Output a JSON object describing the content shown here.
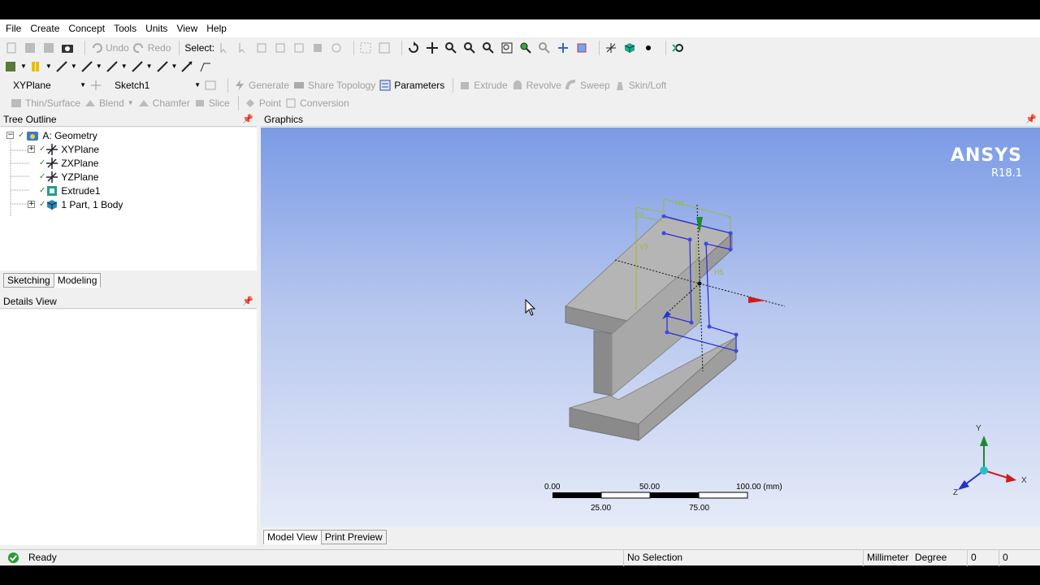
{
  "menubar": [
    "File",
    "Create",
    "Concept",
    "Tools",
    "Units",
    "View",
    "Help"
  ],
  "toolbar1": {
    "undo": "Undo",
    "redo": "Redo",
    "select": "Select:"
  },
  "toolbar3": {
    "plane": "XYPlane",
    "sketch": "Sketch1",
    "generate": "Generate",
    "share_topology": "Share Topology",
    "parameters": "Parameters",
    "extrude": "Extrude",
    "revolve": "Revolve",
    "sweep": "Sweep",
    "skin_loft": "Skin/Loft"
  },
  "toolbar4": {
    "thin_surface": "Thin/Surface",
    "blend": "Blend",
    "chamfer": "Chamfer",
    "slice": "Slice",
    "point": "Point",
    "conversion": "Conversion"
  },
  "tree": {
    "header": "Tree Outline",
    "root": "A: Geometry",
    "items": [
      "XYPlane",
      "ZXPlane",
      "YZPlane",
      "Extrude1",
      "1 Part, 1 Body"
    ]
  },
  "left_tabs": [
    "Sketching",
    "Modeling"
  ],
  "details": {
    "header": "Details View"
  },
  "graphics": {
    "header": "Graphics",
    "brand": "ANSYS",
    "version": "R18.1",
    "dims": {
      "h1": "H1",
      "v2": "V2",
      "v3": "V3",
      "h5": "H5"
    },
    "scale": {
      "top_labels": [
        "0.00",
        "50.00",
        "100.00 (mm)"
      ],
      "bottom_labels": [
        "25.00",
        "75.00"
      ]
    },
    "triad": {
      "x": "X",
      "y": "Y",
      "z": "Z"
    }
  },
  "bottom_tabs": [
    "Model View",
    "Print Preview"
  ],
  "status": {
    "ready": "Ready",
    "selection": "No Selection",
    "units": "Millimeter",
    "angle": "Degree",
    "v1": "0",
    "v2": "0"
  },
  "colors": {
    "graphics_top": "#7b9be6",
    "graphics_bottom": "#e6ebf8",
    "sketch_blue": "#2a2ad8",
    "dim_green": "#9cb83a",
    "axis_red": "#d01c1c",
    "axis_green": "#1a8a2a",
    "axis_blue": "#2233cc"
  }
}
